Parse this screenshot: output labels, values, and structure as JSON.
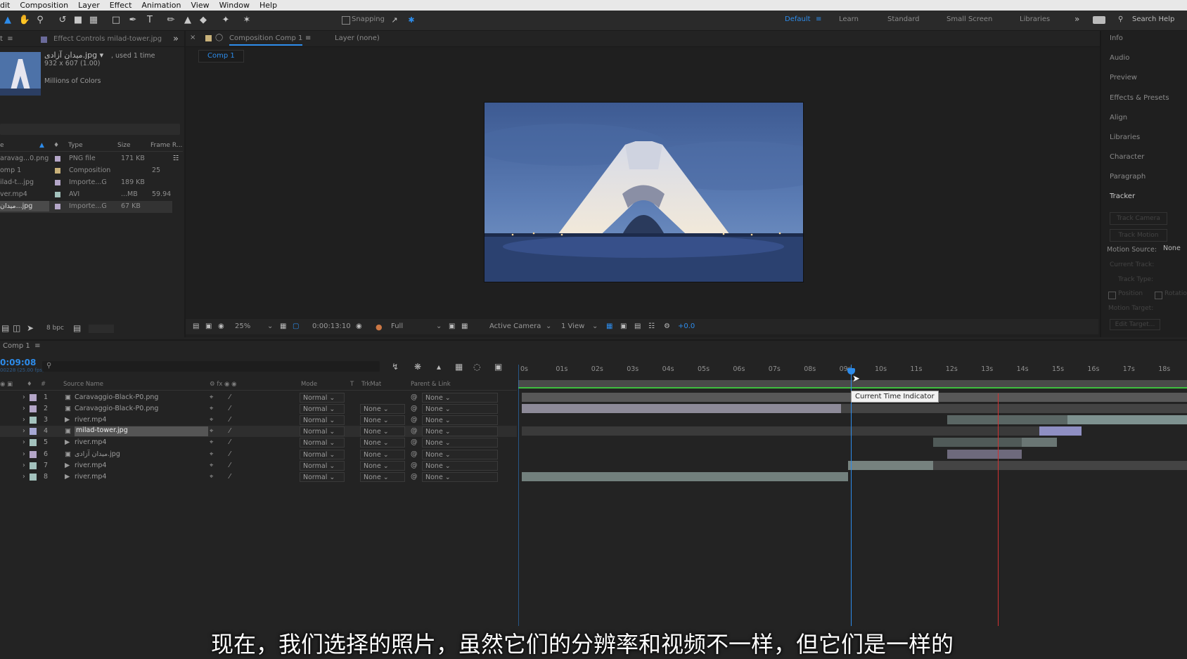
{
  "menu": [
    "dit",
    "Composition",
    "Layer",
    "Effect",
    "Animation",
    "View",
    "Window",
    "Help"
  ],
  "toolbar": {
    "snapping_label": "Snapping",
    "workspaces": [
      "Default",
      "Learn",
      "Standard",
      "Small Screen",
      "Libraries"
    ],
    "active_workspace": "Default",
    "search_help": "Search Help"
  },
  "project": {
    "effect_controls_tab": "Effect Controls milad-tower.jpg",
    "thumb_name": "میدان آزادی.jpg ▾",
    "used": ", used 1 time",
    "dimensions": "932 x 607 (1.00)",
    "colors": "Millions of Colors",
    "columns": [
      "Type",
      "Size",
      "Frame R..."
    ],
    "items": [
      {
        "name": "aravag...0.png",
        "type": "PNG file",
        "size": "171 KB",
        "fps": ""
      },
      {
        "name": "omp 1",
        "type": "Composition",
        "size": "",
        "fps": "25"
      },
      {
        "name": "ilad-t...jpg",
        "type": "Importe...G",
        "size": "189 KB",
        "fps": ""
      },
      {
        "name": "ver.mp4",
        "type": "AVI",
        "size": "...MB",
        "fps": "59.94"
      },
      {
        "name": "میدان...jpg",
        "type": "Importe...G",
        "size": "67 KB",
        "fps": ""
      }
    ],
    "bpc": "8 bpc"
  },
  "viewer": {
    "comp_tab": "Composition Comp 1",
    "layer_tab": "Layer (none)",
    "comp_subtab": "Comp 1",
    "zoom": "25%",
    "timecode": "0:00:13:10",
    "resolution": "Full",
    "camera": "Active Camera",
    "views": "1 View",
    "exposure": "+0.0"
  },
  "right_panel": {
    "items": [
      "Info",
      "Audio",
      "Preview",
      "Effects & Presets",
      "Align",
      "Libraries",
      "Character",
      "Paragraph",
      "Tracker"
    ],
    "tracker_buttons": [
      "Track Camera",
      "Track Motion"
    ],
    "motion_source_label": "Motion Source:",
    "motion_source_value": "None",
    "current_track": "Current Track:",
    "track_type": "Track Type:",
    "position_label": "Position",
    "rotation_label": "Rotatio",
    "motion_target": "Motion Target:",
    "edit_target": "Edit Target..."
  },
  "timeline": {
    "tab": "Comp 1",
    "current_time": "0:09:08",
    "frame_info": "00228 (25.00 fps)",
    "columns": {
      "source": "Source Name",
      "mode": "Mode",
      "t": "T",
      "trkmat": "TrkMat",
      "parent": "Parent & Link"
    },
    "layers": [
      {
        "num": "1",
        "name": "Caravaggio-Black-P0.png",
        "mode": "Normal",
        "trkmat": "",
        "parent": "None",
        "color": "#b4a6c8",
        "kind": "image"
      },
      {
        "num": "2",
        "name": "Caravaggio-Black-P0.png",
        "mode": "Normal",
        "trkmat": "None",
        "parent": "None",
        "color": "#b4a6c8",
        "kind": "image"
      },
      {
        "num": "3",
        "name": "river.mp4",
        "mode": "Normal",
        "trkmat": "None",
        "parent": "None",
        "color": "#a3c2bd",
        "kind": "video"
      },
      {
        "num": "4",
        "name": "milad-tower.jpg",
        "mode": "Normal",
        "trkmat": "None",
        "parent": "None",
        "color": "#a6a8d4",
        "kind": "image"
      },
      {
        "num": "5",
        "name": "river.mp4",
        "mode": "Normal",
        "trkmat": "None",
        "parent": "None",
        "color": "#a3c2bd",
        "kind": "video"
      },
      {
        "num": "6",
        "name": "میدان آزادی.jpg",
        "mode": "Normal",
        "trkmat": "None",
        "parent": "None",
        "color": "#b4a6c8",
        "kind": "image"
      },
      {
        "num": "7",
        "name": "river.mp4",
        "mode": "Normal",
        "trkmat": "None",
        "parent": "None",
        "color": "#a3c2bd",
        "kind": "video"
      },
      {
        "num": "8",
        "name": "river.mp4",
        "mode": "Normal",
        "trkmat": "None",
        "parent": "None",
        "color": "#a3c2bd",
        "kind": "video"
      }
    ],
    "ruler": [
      "0s",
      "01s",
      "02s",
      "03s",
      "04s",
      "05s",
      "06s",
      "07s",
      "08s",
      "09s",
      "10s",
      "11s",
      "12s",
      "13s",
      "14s",
      "15s",
      "16s",
      "17s",
      "18s"
    ],
    "tooltip": "Current Time Indicator"
  },
  "subtitle": "现在，我们选择的照片，虽然它们的分辨率和视频不一样，但它们是一样的",
  "colors": {
    "accent": "#2d8ceb",
    "work_area": "#3fbf3f",
    "end_marker": "#d23232"
  }
}
